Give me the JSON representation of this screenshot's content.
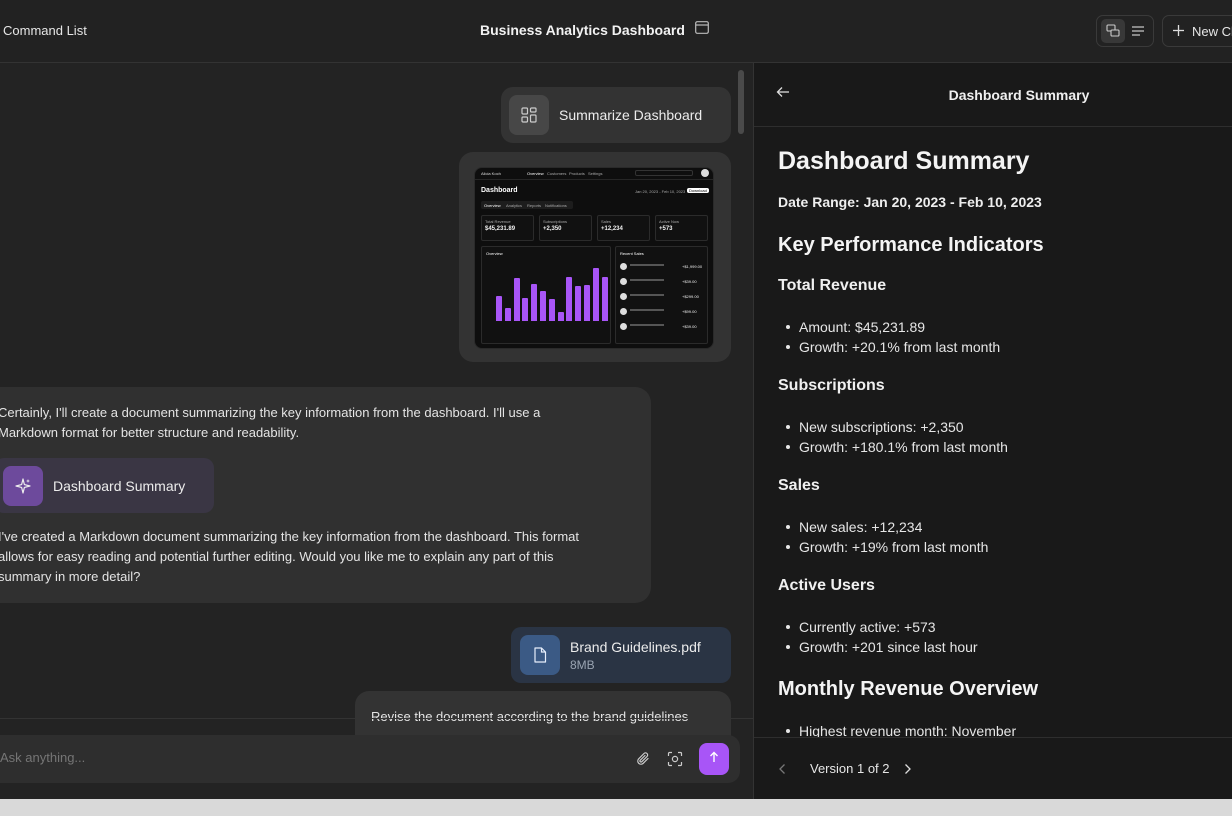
{
  "header": {
    "command_list_label": "Command List",
    "title": "Business Analytics Dashboard",
    "new_chat_label": "New Chat"
  },
  "chat": {
    "command_bubble_label": "Summarize Dashboard",
    "assistant": {
      "intro_line1": "Certainly, I'll create a document summarizing the key information from the dashboard. I'll use a",
      "intro_line2": "Markdown format for better structure and readability.",
      "artifact_label": "Dashboard Summary",
      "outro_line1": "I've created a Markdown document summarizing the key information from the dashboard. This format",
      "outro_line2": "allows for easy reading and potential further editing. Would you like me to explain any part of this",
      "outro_line3": "summary in more detail?"
    },
    "file": {
      "name": "Brand Guidelines.pdf",
      "size": "8MB"
    },
    "user_message": "Revise the document according to the brand guidelines",
    "composer_placeholder": "Ask anything..."
  },
  "thumbnail": {
    "title": "Dashboard",
    "tabs": [
      "Overview",
      "Analytics",
      "Reports",
      "Notifications"
    ],
    "nav": [
      "Overview",
      "Customers",
      "Products",
      "Settings"
    ],
    "date_range": "Jan 20, 2023 - Feb 10, 2023",
    "download": "Download",
    "cards": [
      {
        "label": "Total Revenue",
        "value": "$45,231.89"
      },
      {
        "label": "Subscriptions",
        "value": "+2,350"
      },
      {
        "label": "Sales",
        "value": "+12,234"
      },
      {
        "label": "Active Now",
        "value": "+573"
      }
    ],
    "overview_label": "Overview",
    "recent_sales_label": "Recent Sales",
    "bars": [
      0.42,
      0.22,
      0.72,
      0.38,
      0.62,
      0.5,
      0.36,
      0.15,
      0.74,
      0.58,
      0.6,
      0.88,
      0.74
    ],
    "sales_amounts": [
      "+$1,999.00",
      "+$39.00",
      "+$299.00",
      "+$99.00",
      "+$39.00"
    ]
  },
  "panel": {
    "title": "Dashboard Summary",
    "doc": {
      "h1": "Dashboard Summary",
      "date_range": "Date Range: Jan 20, 2023 - Feb 10, 2023",
      "kpi_heading": "Key Performance Indicators",
      "total_revenue": {
        "heading": "Total Revenue",
        "items": [
          "Amount: $45,231.89",
          "Growth: +20.1% from last month"
        ]
      },
      "subscriptions": {
        "heading": "Subscriptions",
        "items": [
          "New subscriptions: +2,350",
          "Growth: +180.1% from last month"
        ]
      },
      "sales": {
        "heading": "Sales",
        "items": [
          "New sales: +12,234",
          "Growth: +19% from last month"
        ]
      },
      "active_users": {
        "heading": "Active Users",
        "items": [
          "Currently active: +573",
          "Growth: +201 since last hour"
        ]
      },
      "monthly_heading": "Monthly Revenue Overview",
      "monthly_items": [
        "Highest revenue month: November"
      ]
    },
    "version_label": "Version 1 of 2"
  }
}
